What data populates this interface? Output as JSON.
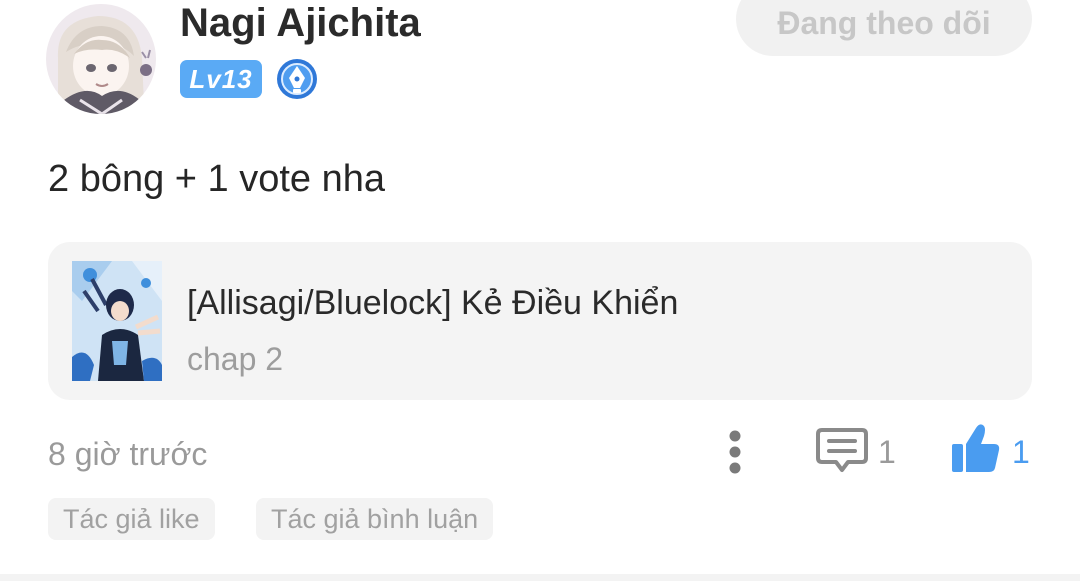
{
  "comment": {
    "author": {
      "name": "Nagi Ajichita",
      "level": "Lv13",
      "avatar_icon": "avatar-anime-girl",
      "badge_icon": "pen-nib-badge-icon"
    },
    "follow_button_label": "Đang theo dõi",
    "text": "2 bông + 1 vote nha",
    "story": {
      "title": "[Allisagi/Bluelock] Kẻ Điều Khiển",
      "chapter": "chap 2",
      "cover_icon": "story-cover-image"
    },
    "timestamp": "8 giờ trước",
    "actions": {
      "more_icon": "more-vertical-icon",
      "reply_icon": "comment-bubble-icon",
      "reply_count": "1",
      "like_icon": "thumbs-up-icon",
      "like_count": "1"
    },
    "tags": [
      {
        "label": "Tác giả like"
      },
      {
        "label": "Tác giả bình luận"
      }
    ]
  },
  "colors": {
    "accent": "#4a9cf0",
    "level_badge": "#5aaaf5",
    "text_primary": "#2b2b2b",
    "text_secondary": "#9a9a9a",
    "card_background": "#f4f4f4"
  }
}
